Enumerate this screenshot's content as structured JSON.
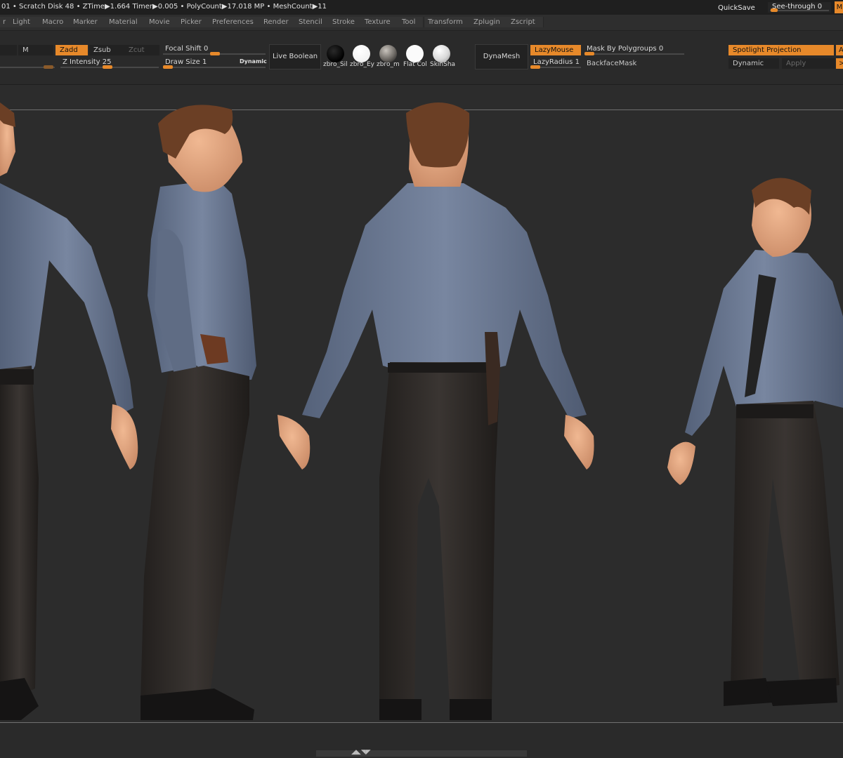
{
  "status": {
    "text": "01 • Scratch Disk 48 • ZTime▶1.664 Timer▶0.005 • PolyCount▶17.018 MP • MeshCount▶11",
    "quicksave": "QuickSave",
    "see_through_label": "See-through  0",
    "see_through_value": 0,
    "menu_toggle": "M"
  },
  "menu": {
    "items": [
      "r",
      "Light",
      "Macro",
      "Marker",
      "Material",
      "Movie",
      "Picker",
      "Preferences",
      "Render",
      "Stencil",
      "Stroke",
      "Texture",
      "Tool",
      "Transform",
      "Zplugin",
      "Zscript"
    ]
  },
  "toolbar": {
    "m_label": "M",
    "zadd": "Zadd",
    "zsub": "Zsub",
    "zcut": "Zcut",
    "z_intensity": "Z Intensity 25",
    "focal_shift": "Focal Shift 0",
    "draw_size": "Draw Size 1",
    "dynamic": "Dynamic",
    "live_boolean": "Live Boolean",
    "materials": [
      "zbro_Sil",
      "zbro_Ey",
      "zbro_m",
      "Flat Col",
      "SkinSha"
    ],
    "dynamesh": "DynaMesh",
    "lazymouse": "LazyMouse",
    "lazyradius": "LazyRadius 1",
    "mask_by_polygroups": "Mask By Polygroups 0",
    "backface_mask": "BackfaceMask",
    "spotlight_projection": "Spotlight Projection",
    "spot_a": "A",
    "spot_dynamic": "Dynamic",
    "spot_apply": "Apply",
    "spot_more": ">"
  },
  "colors": {
    "accent": "#e7892a",
    "shirt": "#6d7b92",
    "pants": "#2e2a27",
    "skin": "#e0a37e",
    "hair": "#6b3f25"
  }
}
